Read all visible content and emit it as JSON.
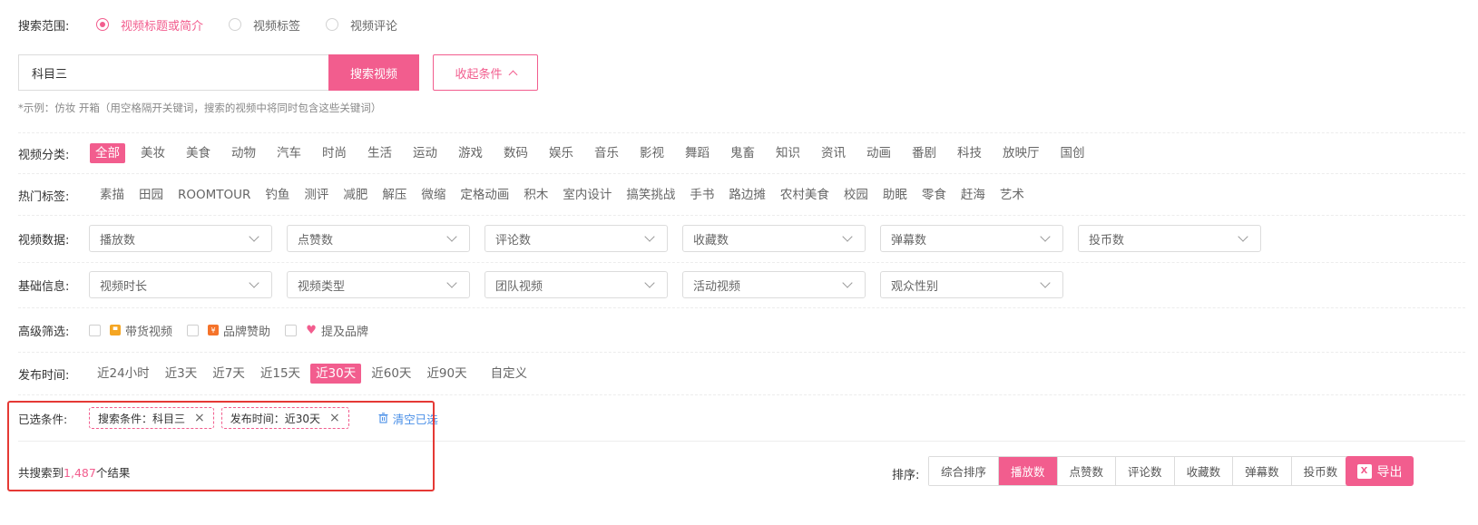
{
  "scope": {
    "label": "搜索范围:",
    "options": [
      {
        "label": "视频标题或简介",
        "checked": true
      },
      {
        "label": "视频标签",
        "checked": false
      },
      {
        "label": "视频评论",
        "checked": false
      }
    ]
  },
  "search": {
    "value": "科目三",
    "button": "搜索视频",
    "collapse": "收起条件",
    "hint": "*示例：仿妆 开箱（用空格隔开关键词，搜索的视频中将同时包含这些关键词）"
  },
  "category": {
    "label": "视频分类:",
    "items": [
      "全部",
      "美妆",
      "美食",
      "动物",
      "汽车",
      "时尚",
      "生活",
      "运动",
      "游戏",
      "数码",
      "娱乐",
      "音乐",
      "影视",
      "舞蹈",
      "鬼畜",
      "知识",
      "资讯",
      "动画",
      "番剧",
      "科技",
      "放映厅",
      "国创"
    ]
  },
  "hot_tags": {
    "label": "热门标签:",
    "items": [
      "素描",
      "田园",
      "ROOMTOUR",
      "钓鱼",
      "测评",
      "减肥",
      "解压",
      "微缩",
      "定格动画",
      "积木",
      "室内设计",
      "搞笑挑战",
      "手书",
      "路边摊",
      "农村美食",
      "校园",
      "助眠",
      "零食",
      "赶海",
      "艺术"
    ]
  },
  "video_data": {
    "label": "视频数据:",
    "selects": [
      "播放数",
      "点赞数",
      "评论数",
      "收藏数",
      "弹幕数",
      "投币数"
    ]
  },
  "basic_info": {
    "label": "基础信息:",
    "selects": [
      "视频时长",
      "视频类型",
      "团队视频",
      "活动视频",
      "观众性别"
    ]
  },
  "advanced": {
    "label": "高级筛选:",
    "options": [
      {
        "label": "带货视频",
        "icon": "shopping-bag-icon",
        "color": "#f5a623"
      },
      {
        "label": "品牌赞助",
        "icon": "yen-icon",
        "color": "#f5732a"
      },
      {
        "label": "提及品牌",
        "icon": "heart-icon",
        "color": "#f25d8e"
      }
    ]
  },
  "publish_time": {
    "label": "发布时间:",
    "items": [
      "近24小时",
      "近3天",
      "近7天",
      "近15天",
      "近30天",
      "近60天",
      "近90天",
      "自定义"
    ],
    "active": "近30天"
  },
  "selected": {
    "label": "已选条件:",
    "chips": [
      "搜索条件：科目三",
      "发布时间：近30天"
    ],
    "clear": "清空已选"
  },
  "result": {
    "prefix": "共搜索到",
    "count": "1,487",
    "suffix": "个结果"
  },
  "sort": {
    "label": "排序:",
    "items": [
      "综合排序",
      "播放数",
      "点赞数",
      "评论数",
      "收藏数",
      "弹幕数",
      "投币数"
    ],
    "active": "播放数"
  },
  "export": {
    "label": "导出",
    "icon_letter": "X"
  },
  "colors": {
    "accent": "#f25d8e",
    "link": "#4a8fe7",
    "highlight": "#e53935"
  }
}
